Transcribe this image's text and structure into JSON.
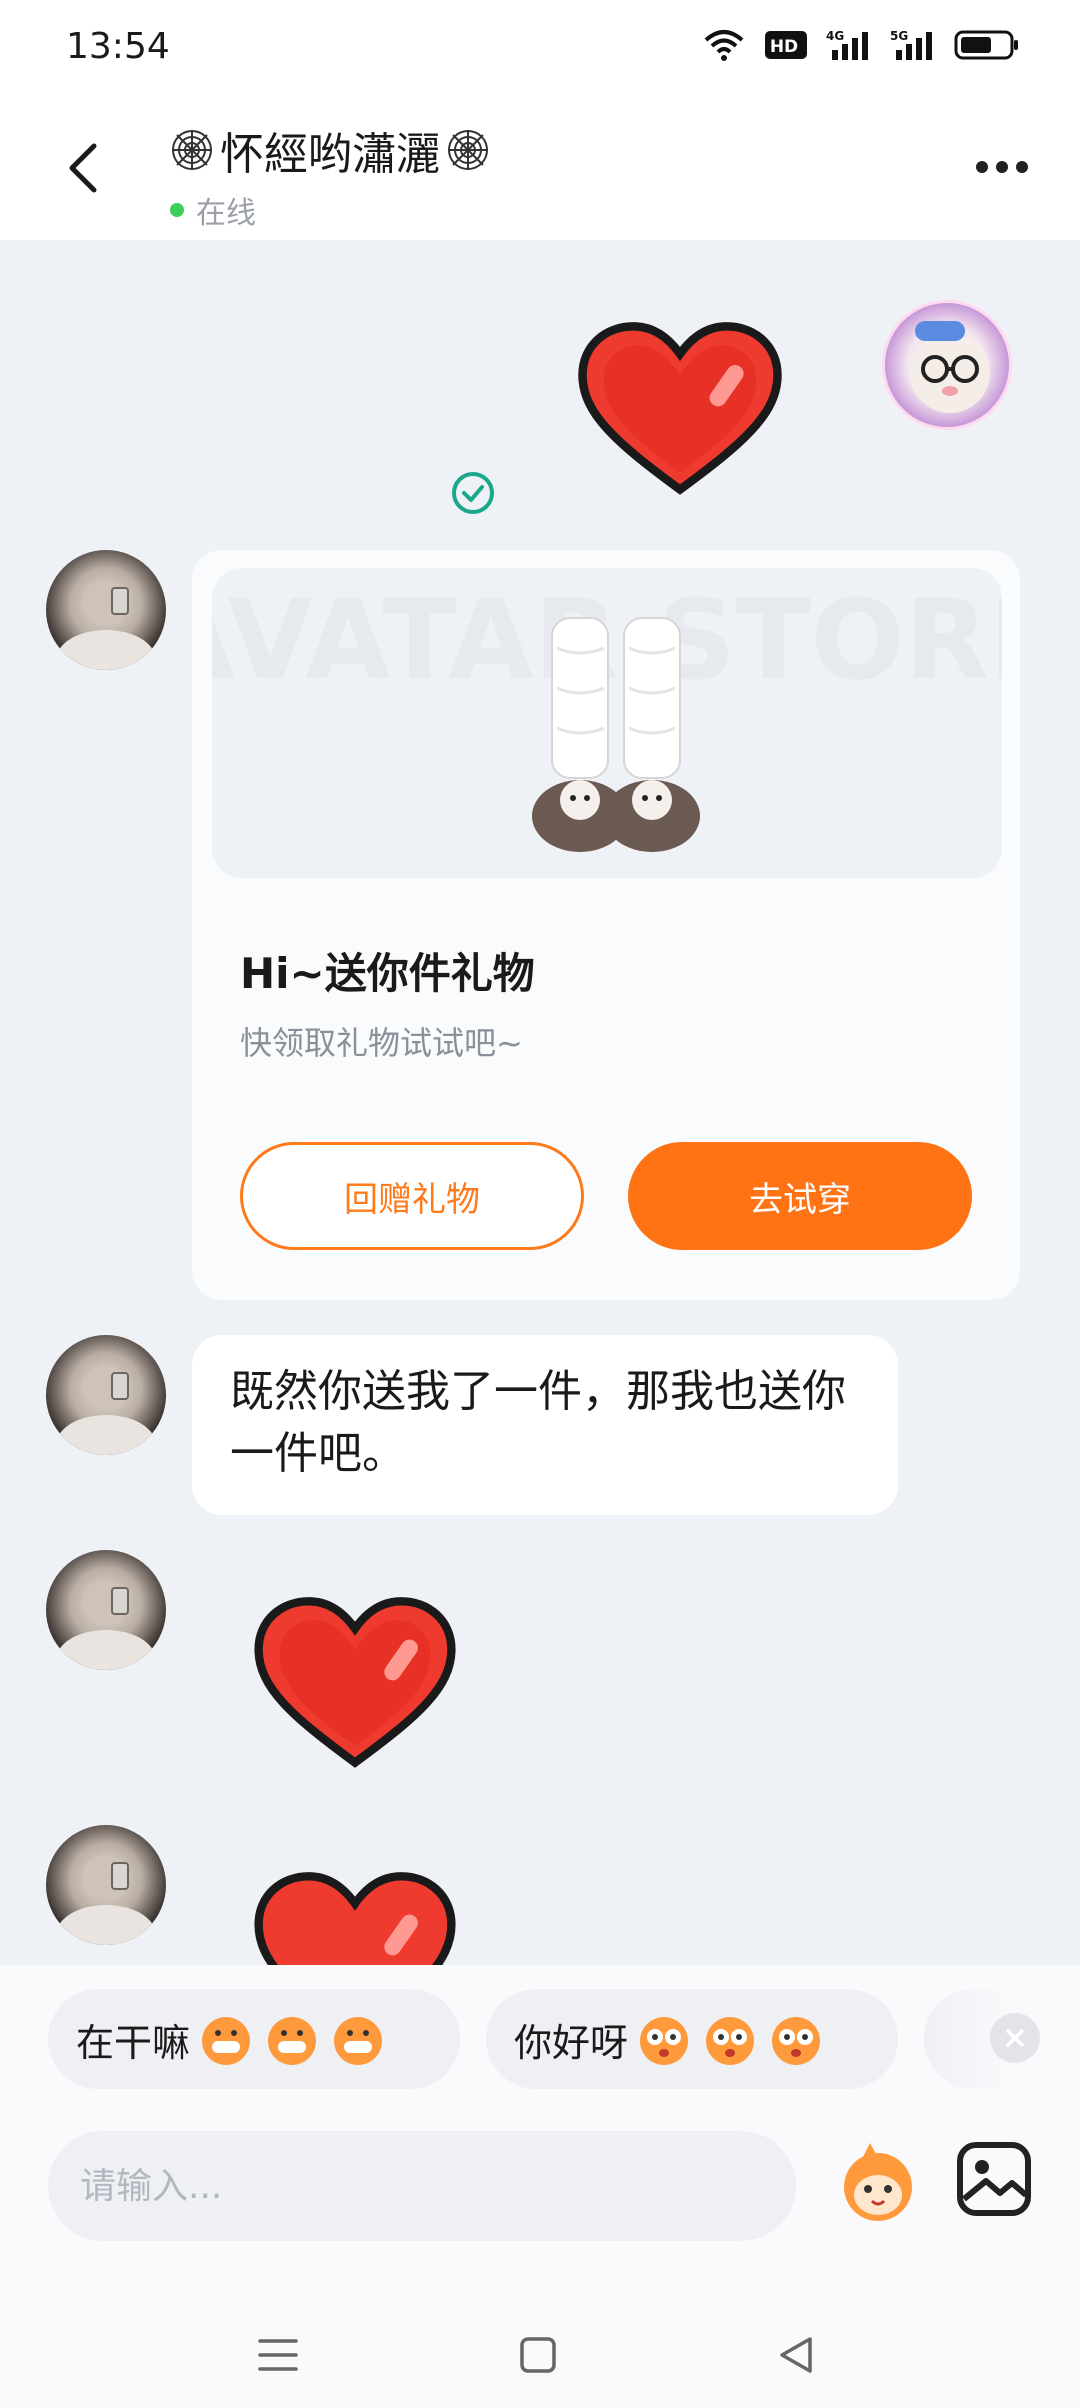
{
  "status_bar": {
    "time": "13:54",
    "icons": [
      "wifi-icon",
      "hd-icon",
      "signal-4g-icon",
      "signal-5g-icon",
      "battery-icon"
    ],
    "hd_label": "HD",
    "net1": "4G",
    "net2": "5G"
  },
  "header": {
    "title": "怀經哟瀟灑",
    "status": "在线"
  },
  "messages": {
    "gift_card": {
      "title": "Hi~送你件礼物",
      "subtitle": "快领取礼物试试吧~",
      "return_button": "回赠礼物",
      "try_button": "去试穿",
      "image_watermark": "AVATAR STORE"
    },
    "text": "既然你送我了一件，那我也送你一件吧。"
  },
  "quick_replies": [
    {
      "label": "在干嘛"
    },
    {
      "label": "你好呀"
    }
  ],
  "input": {
    "placeholder": "请输入..."
  },
  "colors": {
    "accent": "#ff7314",
    "online": "#3ccf5a",
    "background": "#eef1f6",
    "check": "#1aa88a"
  }
}
